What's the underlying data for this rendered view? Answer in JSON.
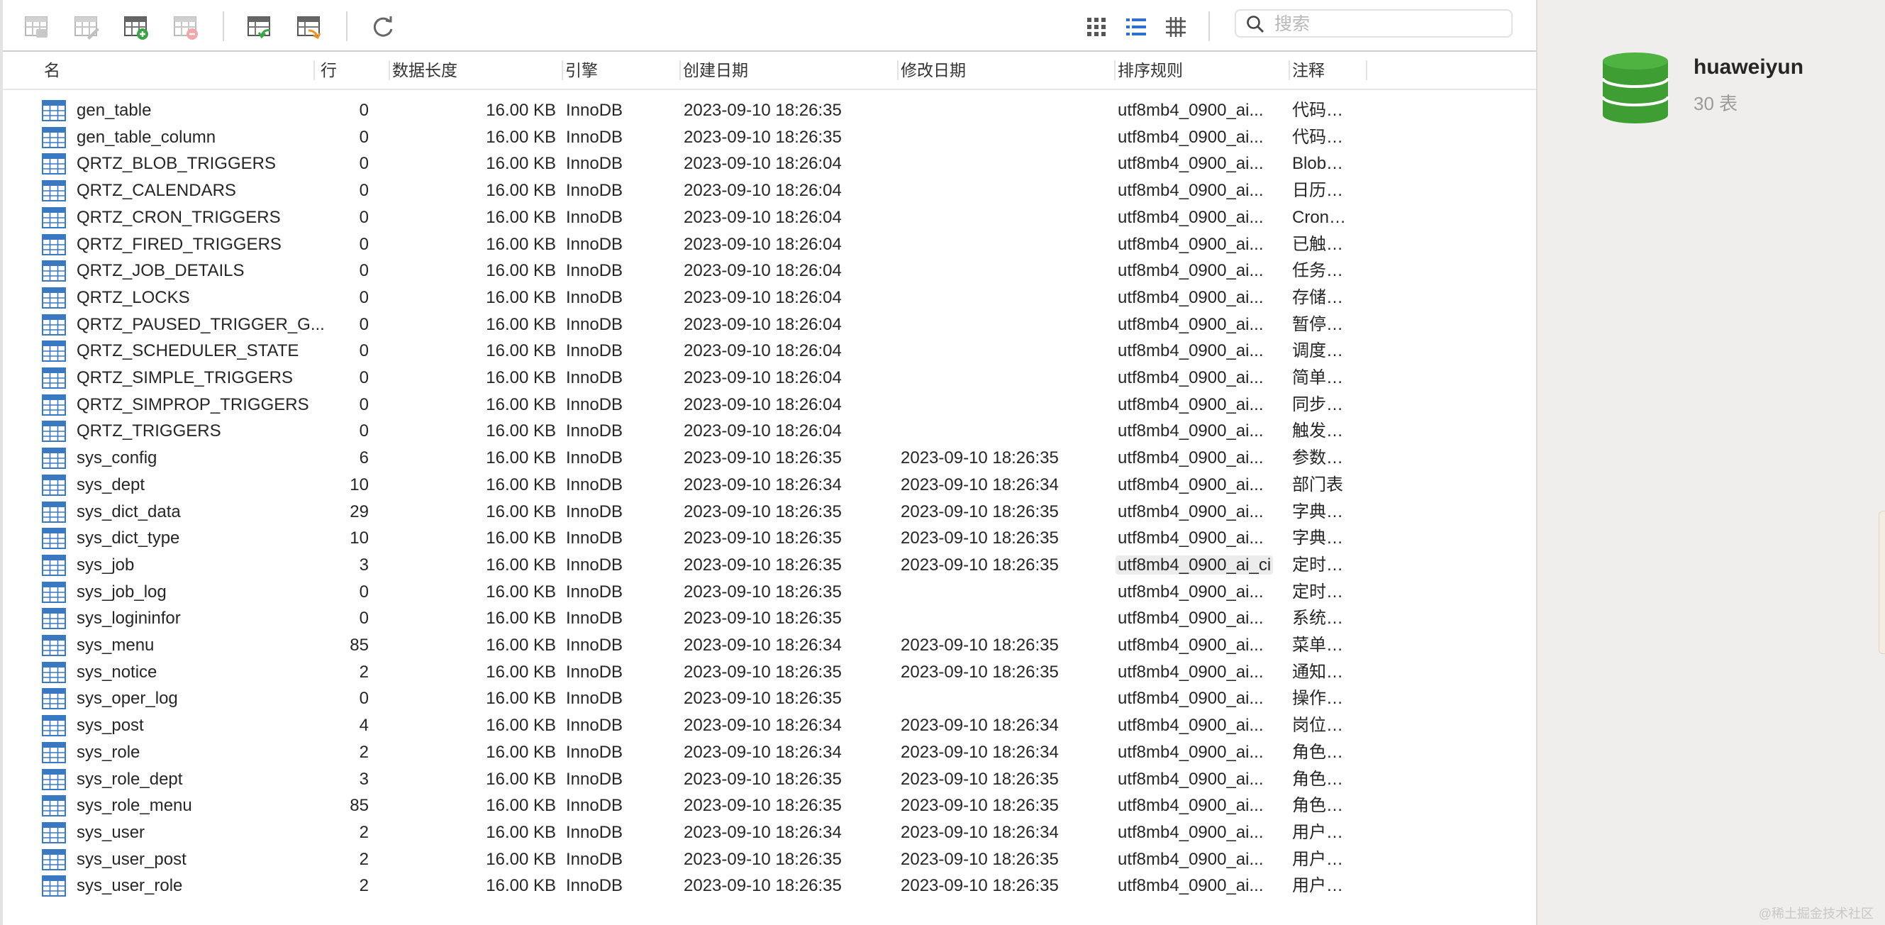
{
  "search": {
    "placeholder": "搜索"
  },
  "toolbar": {
    "icons": [
      "open-table-icon",
      "design-table-icon",
      "new-table-icon",
      "delete-table-icon",
      "import-icon",
      "export-icon",
      "refresh-icon",
      "grid-view-icon",
      "list-view-icon",
      "detail-view-icon",
      "search-icon"
    ]
  },
  "columns": [
    {
      "key": "name",
      "label": "名"
    },
    {
      "key": "rows",
      "label": "行"
    },
    {
      "key": "data_length",
      "label": "数据长度"
    },
    {
      "key": "engine",
      "label": "引擎"
    },
    {
      "key": "created",
      "label": "创建日期"
    },
    {
      "key": "modified",
      "label": "修改日期"
    },
    {
      "key": "collation",
      "label": "排序规则"
    },
    {
      "key": "comment",
      "label": "注释"
    }
  ],
  "tables": [
    {
      "name": "gen_table",
      "rows": "0",
      "data_length": "16.00 KB",
      "engine": "InnoDB",
      "created": "2023-09-10 18:26:35",
      "modified": "",
      "collation": "utf8mb4_0900_ai...",
      "comment": "代码…"
    },
    {
      "name": "gen_table_column",
      "rows": "0",
      "data_length": "16.00 KB",
      "engine": "InnoDB",
      "created": "2023-09-10 18:26:35",
      "modified": "",
      "collation": "utf8mb4_0900_ai...",
      "comment": "代码…"
    },
    {
      "name": "QRTZ_BLOB_TRIGGERS",
      "rows": "0",
      "data_length": "16.00 KB",
      "engine": "InnoDB",
      "created": "2023-09-10 18:26:04",
      "modified": "",
      "collation": "utf8mb4_0900_ai...",
      "comment": "Blob…"
    },
    {
      "name": "QRTZ_CALENDARS",
      "rows": "0",
      "data_length": "16.00 KB",
      "engine": "InnoDB",
      "created": "2023-09-10 18:26:04",
      "modified": "",
      "collation": "utf8mb4_0900_ai...",
      "comment": "日历…"
    },
    {
      "name": "QRTZ_CRON_TRIGGERS",
      "rows": "0",
      "data_length": "16.00 KB",
      "engine": "InnoDB",
      "created": "2023-09-10 18:26:04",
      "modified": "",
      "collation": "utf8mb4_0900_ai...",
      "comment": "Cron…"
    },
    {
      "name": "QRTZ_FIRED_TRIGGERS",
      "rows": "0",
      "data_length": "16.00 KB",
      "engine": "InnoDB",
      "created": "2023-09-10 18:26:04",
      "modified": "",
      "collation": "utf8mb4_0900_ai...",
      "comment": "已触…"
    },
    {
      "name": "QRTZ_JOB_DETAILS",
      "rows": "0",
      "data_length": "16.00 KB",
      "engine": "InnoDB",
      "created": "2023-09-10 18:26:04",
      "modified": "",
      "collation": "utf8mb4_0900_ai...",
      "comment": "任务…"
    },
    {
      "name": "QRTZ_LOCKS",
      "rows": "0",
      "data_length": "16.00 KB",
      "engine": "InnoDB",
      "created": "2023-09-10 18:26:04",
      "modified": "",
      "collation": "utf8mb4_0900_ai...",
      "comment": "存储…"
    },
    {
      "name": "QRTZ_PAUSED_TRIGGER_G...",
      "rows": "0",
      "data_length": "16.00 KB",
      "engine": "InnoDB",
      "created": "2023-09-10 18:26:04",
      "modified": "",
      "collation": "utf8mb4_0900_ai...",
      "comment": "暂停…"
    },
    {
      "name": "QRTZ_SCHEDULER_STATE",
      "rows": "0",
      "data_length": "16.00 KB",
      "engine": "InnoDB",
      "created": "2023-09-10 18:26:04",
      "modified": "",
      "collation": "utf8mb4_0900_ai...",
      "comment": "调度…"
    },
    {
      "name": "QRTZ_SIMPLE_TRIGGERS",
      "rows": "0",
      "data_length": "16.00 KB",
      "engine": "InnoDB",
      "created": "2023-09-10 18:26:04",
      "modified": "",
      "collation": "utf8mb4_0900_ai...",
      "comment": "简单…"
    },
    {
      "name": "QRTZ_SIMPROP_TRIGGERS",
      "rows": "0",
      "data_length": "16.00 KB",
      "engine": "InnoDB",
      "created": "2023-09-10 18:26:04",
      "modified": "",
      "collation": "utf8mb4_0900_ai...",
      "comment": "同步…"
    },
    {
      "name": "QRTZ_TRIGGERS",
      "rows": "0",
      "data_length": "16.00 KB",
      "engine": "InnoDB",
      "created": "2023-09-10 18:26:04",
      "modified": "",
      "collation": "utf8mb4_0900_ai...",
      "comment": "触发…"
    },
    {
      "name": "sys_config",
      "rows": "6",
      "data_length": "16.00 KB",
      "engine": "InnoDB",
      "created": "2023-09-10 18:26:35",
      "modified": "2023-09-10 18:26:35",
      "collation": "utf8mb4_0900_ai...",
      "comment": "参数…"
    },
    {
      "name": "sys_dept",
      "rows": "10",
      "data_length": "16.00 KB",
      "engine": "InnoDB",
      "created": "2023-09-10 18:26:34",
      "modified": "2023-09-10 18:26:34",
      "collation": "utf8mb4_0900_ai...",
      "comment": "部门表"
    },
    {
      "name": "sys_dict_data",
      "rows": "29",
      "data_length": "16.00 KB",
      "engine": "InnoDB",
      "created": "2023-09-10 18:26:35",
      "modified": "2023-09-10 18:26:35",
      "collation": "utf8mb4_0900_ai...",
      "comment": "字典…"
    },
    {
      "name": "sys_dict_type",
      "rows": "10",
      "data_length": "16.00 KB",
      "engine": "InnoDB",
      "created": "2023-09-10 18:26:35",
      "modified": "2023-09-10 18:26:35",
      "collation": "utf8mb4_0900_ai...",
      "comment": "字典…"
    },
    {
      "name": "sys_job",
      "rows": "3",
      "data_length": "16.00 KB",
      "engine": "InnoDB",
      "created": "2023-09-10 18:26:35",
      "modified": "2023-09-10 18:26:35",
      "collation": "utf8mb4_0900_ai_ci",
      "comment": "定时…"
    },
    {
      "name": "sys_job_log",
      "rows": "0",
      "data_length": "16.00 KB",
      "engine": "InnoDB",
      "created": "2023-09-10 18:26:35",
      "modified": "",
      "collation": "utf8mb4_0900_ai...",
      "comment": "定时…"
    },
    {
      "name": "sys_logininfor",
      "rows": "0",
      "data_length": "16.00 KB",
      "engine": "InnoDB",
      "created": "2023-09-10 18:26:35",
      "modified": "",
      "collation": "utf8mb4_0900_ai...",
      "comment": "系统…"
    },
    {
      "name": "sys_menu",
      "rows": "85",
      "data_length": "16.00 KB",
      "engine": "InnoDB",
      "created": "2023-09-10 18:26:34",
      "modified": "2023-09-10 18:26:35",
      "collation": "utf8mb4_0900_ai...",
      "comment": "菜单…"
    },
    {
      "name": "sys_notice",
      "rows": "2",
      "data_length": "16.00 KB",
      "engine": "InnoDB",
      "created": "2023-09-10 18:26:35",
      "modified": "2023-09-10 18:26:35",
      "collation": "utf8mb4_0900_ai...",
      "comment": "通知…"
    },
    {
      "name": "sys_oper_log",
      "rows": "0",
      "data_length": "16.00 KB",
      "engine": "InnoDB",
      "created": "2023-09-10 18:26:35",
      "modified": "",
      "collation": "utf8mb4_0900_ai...",
      "comment": "操作…"
    },
    {
      "name": "sys_post",
      "rows": "4",
      "data_length": "16.00 KB",
      "engine": "InnoDB",
      "created": "2023-09-10 18:26:34",
      "modified": "2023-09-10 18:26:34",
      "collation": "utf8mb4_0900_ai...",
      "comment": "岗位…"
    },
    {
      "name": "sys_role",
      "rows": "2",
      "data_length": "16.00 KB",
      "engine": "InnoDB",
      "created": "2023-09-10 18:26:34",
      "modified": "2023-09-10 18:26:34",
      "collation": "utf8mb4_0900_ai...",
      "comment": "角色…"
    },
    {
      "name": "sys_role_dept",
      "rows": "3",
      "data_length": "16.00 KB",
      "engine": "InnoDB",
      "created": "2023-09-10 18:26:35",
      "modified": "2023-09-10 18:26:35",
      "collation": "utf8mb4_0900_ai...",
      "comment": "角色…"
    },
    {
      "name": "sys_role_menu",
      "rows": "85",
      "data_length": "16.00 KB",
      "engine": "InnoDB",
      "created": "2023-09-10 18:26:35",
      "modified": "2023-09-10 18:26:35",
      "collation": "utf8mb4_0900_ai...",
      "comment": "角色…"
    },
    {
      "name": "sys_user",
      "rows": "2",
      "data_length": "16.00 KB",
      "engine": "InnoDB",
      "created": "2023-09-10 18:26:34",
      "modified": "2023-09-10 18:26:34",
      "collation": "utf8mb4_0900_ai...",
      "comment": "用户…"
    },
    {
      "name": "sys_user_post",
      "rows": "2",
      "data_length": "16.00 KB",
      "engine": "InnoDB",
      "created": "2023-09-10 18:26:35",
      "modified": "2023-09-10 18:26:35",
      "collation": "utf8mb4_0900_ai...",
      "comment": "用户…"
    },
    {
      "name": "sys_user_role",
      "rows": "2",
      "data_length": "16.00 KB",
      "engine": "InnoDB",
      "created": "2023-09-10 18:26:35",
      "modified": "2023-09-10 18:26:35",
      "collation": "utf8mb4_0900_ai...",
      "comment": "用户…"
    }
  ],
  "highlighted_cell": {
    "row": 17,
    "column": "collation"
  },
  "sidebar": {
    "database_name": "huaweiyun",
    "table_count": "30 表",
    "icon": "database-icon"
  },
  "watermark": "@稀土掘金技术社区",
  "colors": {
    "accent_blue": "#2f6fd0",
    "table_icon_blue": "#3a78c2",
    "database_green": "#3f9e33",
    "add_green": "#3aa542",
    "delete_red": "#e05a5a",
    "sidebar_bg": "#f0eeed"
  }
}
